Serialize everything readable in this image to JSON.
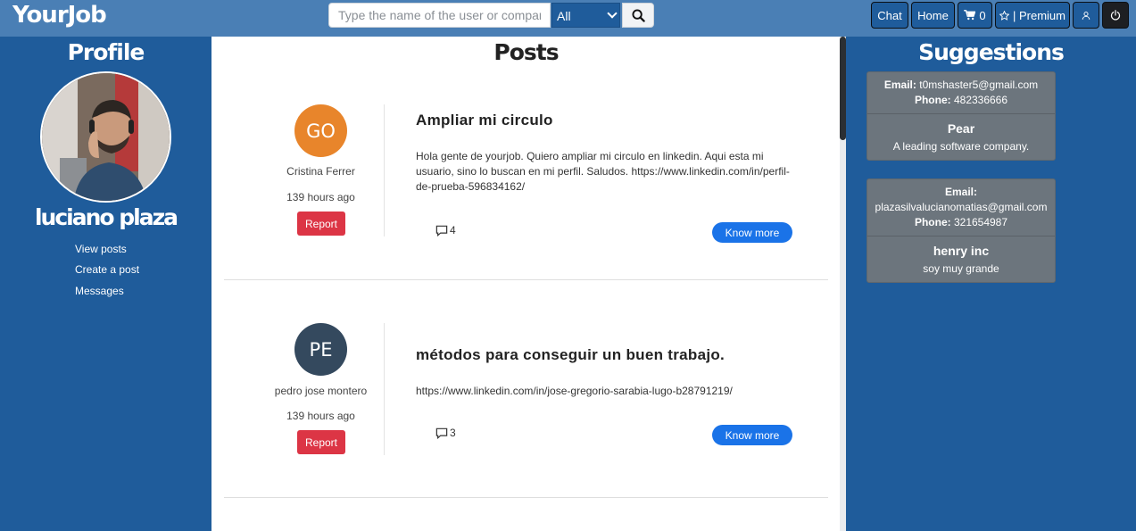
{
  "brand": "YourJob",
  "search": {
    "placeholder": "Type the name of the user or company",
    "filter_value": "All"
  },
  "nav": {
    "chat": "Chat",
    "home": "Home",
    "cart_count": "0",
    "premium": "| Premium"
  },
  "profile": {
    "title": "Profile",
    "name": "luciano plaza",
    "links": [
      "View posts",
      "Create a post",
      "Messages"
    ]
  },
  "posts": {
    "title": "Posts",
    "items": [
      {
        "initials": "GO",
        "avatar_color": "#e8852b",
        "author": "Cristina Ferrer",
        "time": "139 hours ago",
        "report": "Report",
        "title": "Ampliar mi circulo",
        "body": "Hola gente de yourjob. Quiero ampliar mi circulo en linkedin. Aqui esta mi usuario, sino lo buscan en mi perfil. Saludos. https://www.linkedin.com/in/perfil-de-prueba-596834162/",
        "comments": "4",
        "know_more": "Know more"
      },
      {
        "initials": "PE",
        "avatar_color": "#34495e",
        "author": "pedro jose montero",
        "time": "139 hours ago",
        "report": "Report",
        "title": "métodos para conseguir un buen trabajo.",
        "body": "https://www.linkedin.com/in/jose-gregorio-sarabia-lugo-b28791219/",
        "comments": "3",
        "know_more": "Know more"
      }
    ]
  },
  "suggestions": {
    "title": "Suggestions",
    "email_label": "Email:",
    "phone_label": "Phone:",
    "items": [
      {
        "email": "t0mshaster5@gmail.com",
        "phone": "482336666",
        "name": "Pear",
        "description": "A leading software company."
      },
      {
        "email": "plazasilvalucianomatias@gmail.com",
        "phone": "321654987",
        "name": "henry inc",
        "description": "soy muy grande"
      }
    ]
  },
  "colors": {
    "page_bg": "#1f5c9b",
    "navbar_bg": "#4a7fb5",
    "report": "#dc3545",
    "know_more": "#1a73e8",
    "card_bg": "#6c757d"
  }
}
